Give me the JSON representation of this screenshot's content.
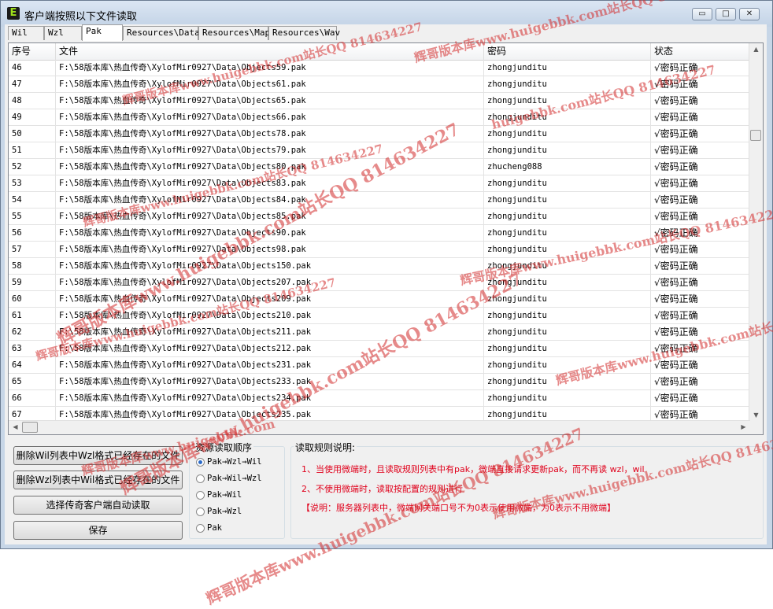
{
  "window": {
    "title": "客户端按照以下文件读取",
    "icon_letter": "E",
    "minimize_glyph": "▭",
    "maximize_glyph": "□",
    "close_glyph": "✕"
  },
  "tabs": [
    {
      "label": "Wil",
      "active": false
    },
    {
      "label": "Wzl",
      "active": false
    },
    {
      "label": "Pak",
      "active": true
    },
    {
      "label": "Resources\\Data",
      "active": false
    },
    {
      "label": "Resources\\Map",
      "active": false
    },
    {
      "label": "Resources\\Wav",
      "active": false
    }
  ],
  "list": {
    "columns": [
      "序号",
      "文件",
      "密码",
      "状态"
    ],
    "rows": [
      {
        "no": "46",
        "file": "F:\\58版本库\\热血传奇\\XylofMir0927\\Data\\Objects59.pak",
        "password": "zhongjunditu",
        "status": "√密码正确"
      },
      {
        "no": "47",
        "file": "F:\\58版本库\\热血传奇\\XylofMir0927\\Data\\Objects61.pak",
        "password": "zhongjunditu",
        "status": "√密码正确"
      },
      {
        "no": "48",
        "file": "F:\\58版本库\\热血传奇\\XylofMir0927\\Data\\Objects65.pak",
        "password": "zhongjunditu",
        "status": "√密码正确"
      },
      {
        "no": "49",
        "file": "F:\\58版本库\\热血传奇\\XylofMir0927\\Data\\Objects66.pak",
        "password": "zhongjunditu",
        "status": "√密码正确"
      },
      {
        "no": "50",
        "file": "F:\\58版本库\\热血传奇\\XylofMir0927\\Data\\Objects78.pak",
        "password": "zhongjunditu",
        "status": "√密码正确"
      },
      {
        "no": "51",
        "file": "F:\\58版本库\\热血传奇\\XylofMir0927\\Data\\Objects79.pak",
        "password": "zhongjunditu",
        "status": "√密码正确"
      },
      {
        "no": "52",
        "file": "F:\\58版本库\\热血传奇\\XylofMir0927\\Data\\Objects80.pak",
        "password": "zhucheng088",
        "status": "√密码正确"
      },
      {
        "no": "53",
        "file": "F:\\58版本库\\热血传奇\\XylofMir0927\\Data\\Objects83.pak",
        "password": "zhongjunditu",
        "status": "√密码正确"
      },
      {
        "no": "54",
        "file": "F:\\58版本库\\热血传奇\\XylofMir0927\\Data\\Objects84.pak",
        "password": "zhongjunditu",
        "status": "√密码正确"
      },
      {
        "no": "55",
        "file": "F:\\58版本库\\热血传奇\\XylofMir0927\\Data\\Objects85.pak",
        "password": "zhongjunditu",
        "status": "√密码正确"
      },
      {
        "no": "56",
        "file": "F:\\58版本库\\热血传奇\\XylofMir0927\\Data\\Objects90.pak",
        "password": "zhongjunditu",
        "status": "√密码正确"
      },
      {
        "no": "57",
        "file": "F:\\58版本库\\热血传奇\\XylofMir0927\\Data\\Objects98.pak",
        "password": "zhongjunditu",
        "status": "√密码正确"
      },
      {
        "no": "58",
        "file": "F:\\58版本库\\热血传奇\\XylofMir0927\\Data\\Objects150.pak",
        "password": "zhongjunditu",
        "status": "√密码正确"
      },
      {
        "no": "59",
        "file": "F:\\58版本库\\热血传奇\\XylofMir0927\\Data\\Objects207.pak",
        "password": "zhongjunditu",
        "status": "√密码正确"
      },
      {
        "no": "60",
        "file": "F:\\58版本库\\热血传奇\\XylofMir0927\\Data\\Objects209.pak",
        "password": "zhongjunditu",
        "status": "√密码正确"
      },
      {
        "no": "61",
        "file": "F:\\58版本库\\热血传奇\\XylofMir0927\\Data\\Objects210.pak",
        "password": "zhongjunditu",
        "status": "√密码正确"
      },
      {
        "no": "62",
        "file": "F:\\58版本库\\热血传奇\\XylofMir0927\\Data\\Objects211.pak",
        "password": "zhongjunditu",
        "status": "√密码正确"
      },
      {
        "no": "63",
        "file": "F:\\58版本库\\热血传奇\\XylofMir0927\\Data\\Objects212.pak",
        "password": "zhongjunditu",
        "status": "√密码正确"
      },
      {
        "no": "64",
        "file": "F:\\58版本库\\热血传奇\\XylofMir0927\\Data\\Objects231.pak",
        "password": "zhongjunditu",
        "status": "√密码正确"
      },
      {
        "no": "65",
        "file": "F:\\58版本库\\热血传奇\\XylofMir0927\\Data\\Objects233.pak",
        "password": "zhongjunditu",
        "status": "√密码正确"
      },
      {
        "no": "66",
        "file": "F:\\58版本库\\热血传奇\\XylofMir0927\\Data\\Objects234.pak",
        "password": "zhongjunditu",
        "status": "√密码正确"
      },
      {
        "no": "67",
        "file": "F:\\58版本库\\热血传奇\\XylofMir0927\\Data\\Objects235.pak",
        "password": "zhongjunditu",
        "status": "√密码正确"
      }
    ]
  },
  "buttons": {
    "delete_wil": "删除Wil列表中Wzl格式已经存在的文件",
    "delete_wzl": "删除Wzl列表中Wil格式已经存在的文件",
    "auto_read": "选择传奇客户端自动读取",
    "save": "保存"
  },
  "order": {
    "title": "资源读取顺序",
    "options": [
      "Pak→Wzl→Wil",
      "Pak→Wil→Wzl",
      "Pak→Wil",
      "Pak→Wzl",
      "Pak"
    ],
    "selected": "Pak→Wzl→Wil"
  },
  "rules": {
    "title": "读取规则说明:",
    "line1": "1、当使用微端时，且读取规则列表中有pak，微端直接请求更新pak，而不再读 wzl，wil",
    "line2": "2、不使用微端时，读取按配置的规则进行",
    "line3": "【说明：服务器列表中，微端网关端口号不为0表示使用微端，为0表示不用微端】"
  },
  "watermarks": {
    "a": "辉哥版本库www.huigebbk.com站长QQ 814634227",
    "b": "huigebbk.com站长QQ 814634227",
    "c": "辉哥版本库www.huigebbk.com"
  },
  "colors": {
    "rule_text": "#e0001b",
    "watermark": "#d32b2b",
    "radio_selected": "#2a6ac8"
  }
}
